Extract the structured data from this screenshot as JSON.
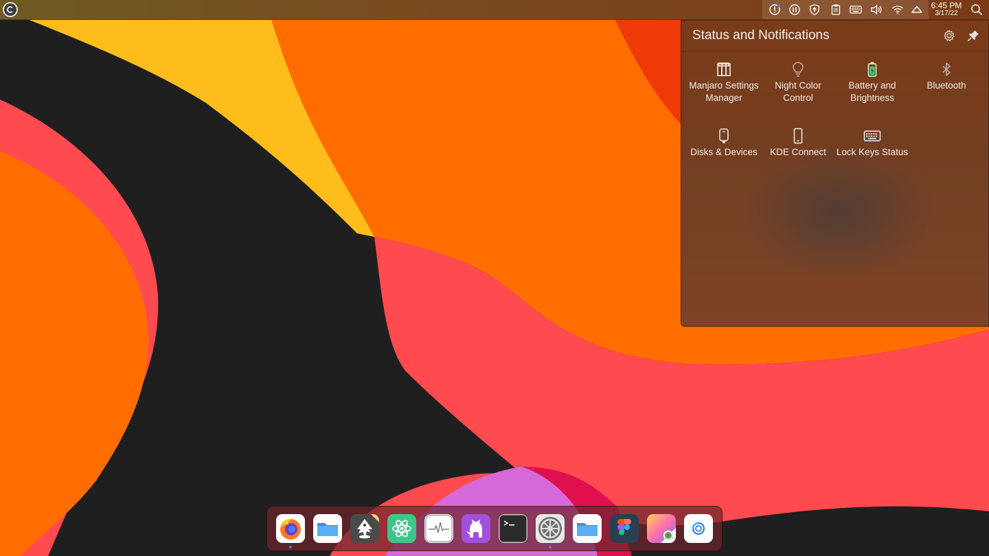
{
  "panel": {
    "app_menu_icon": "manjaro-logo-icon",
    "tray_icons": [
      "notification-alert-icon",
      "pause-icon",
      "update-arrow-icon",
      "clipboard-icon",
      "keyboard-icon",
      "volume-icon",
      "wifi-icon",
      "cloud-icon"
    ],
    "clock_time": "6:45 PM",
    "clock_date": "3/17/22",
    "search_icon": "search-icon"
  },
  "popup": {
    "title": "Status and Notifications",
    "header_buttons": [
      "gear-icon",
      "pin-icon"
    ],
    "tiles": [
      {
        "label": "Manjaro Settings Manager",
        "icon": "manjaro-settings-icon"
      },
      {
        "label": "Night Color Control",
        "icon": "lightbulb-icon"
      },
      {
        "label": "Battery and Brightness",
        "icon": "battery-icon"
      },
      {
        "label": "Bluetooth",
        "icon": "bluetooth-icon"
      },
      {
        "label": "Disks & Devices",
        "icon": "disk-device-icon"
      },
      {
        "label": "KDE Connect",
        "icon": "phone-icon"
      },
      {
        "label": "Lock Keys Status",
        "icon": "keyboard-icon"
      }
    ]
  },
  "dock": {
    "apps": [
      {
        "name": "firefox-icon",
        "running": true
      },
      {
        "name": "files-icon",
        "running": false
      },
      {
        "name": "inkscape-icon",
        "running": false
      },
      {
        "name": "atom-icon",
        "running": false
      },
      {
        "name": "system-monitor-icon",
        "running": false
      },
      {
        "name": "github-desktop-icon",
        "running": false
      },
      {
        "name": "terminal-icon",
        "running": false
      },
      {
        "name": "system-settings-icon",
        "running": true
      },
      {
        "name": "folder-icon",
        "running": false
      },
      {
        "name": "figma-icon",
        "running": false
      },
      {
        "name": "color-picker-icon",
        "running": false
      },
      {
        "name": "browser-icon",
        "running": false
      }
    ]
  },
  "colors": {
    "wallpaper_orange": "#ff6d00",
    "wallpaper_yellow": "#ffbd1c",
    "wallpaper_red": "#ff4a4f",
    "wallpaper_dark": "#1f1f1f",
    "wallpaper_magenta": "#d569d9",
    "accent_running_dot": "#3d7fe8"
  }
}
